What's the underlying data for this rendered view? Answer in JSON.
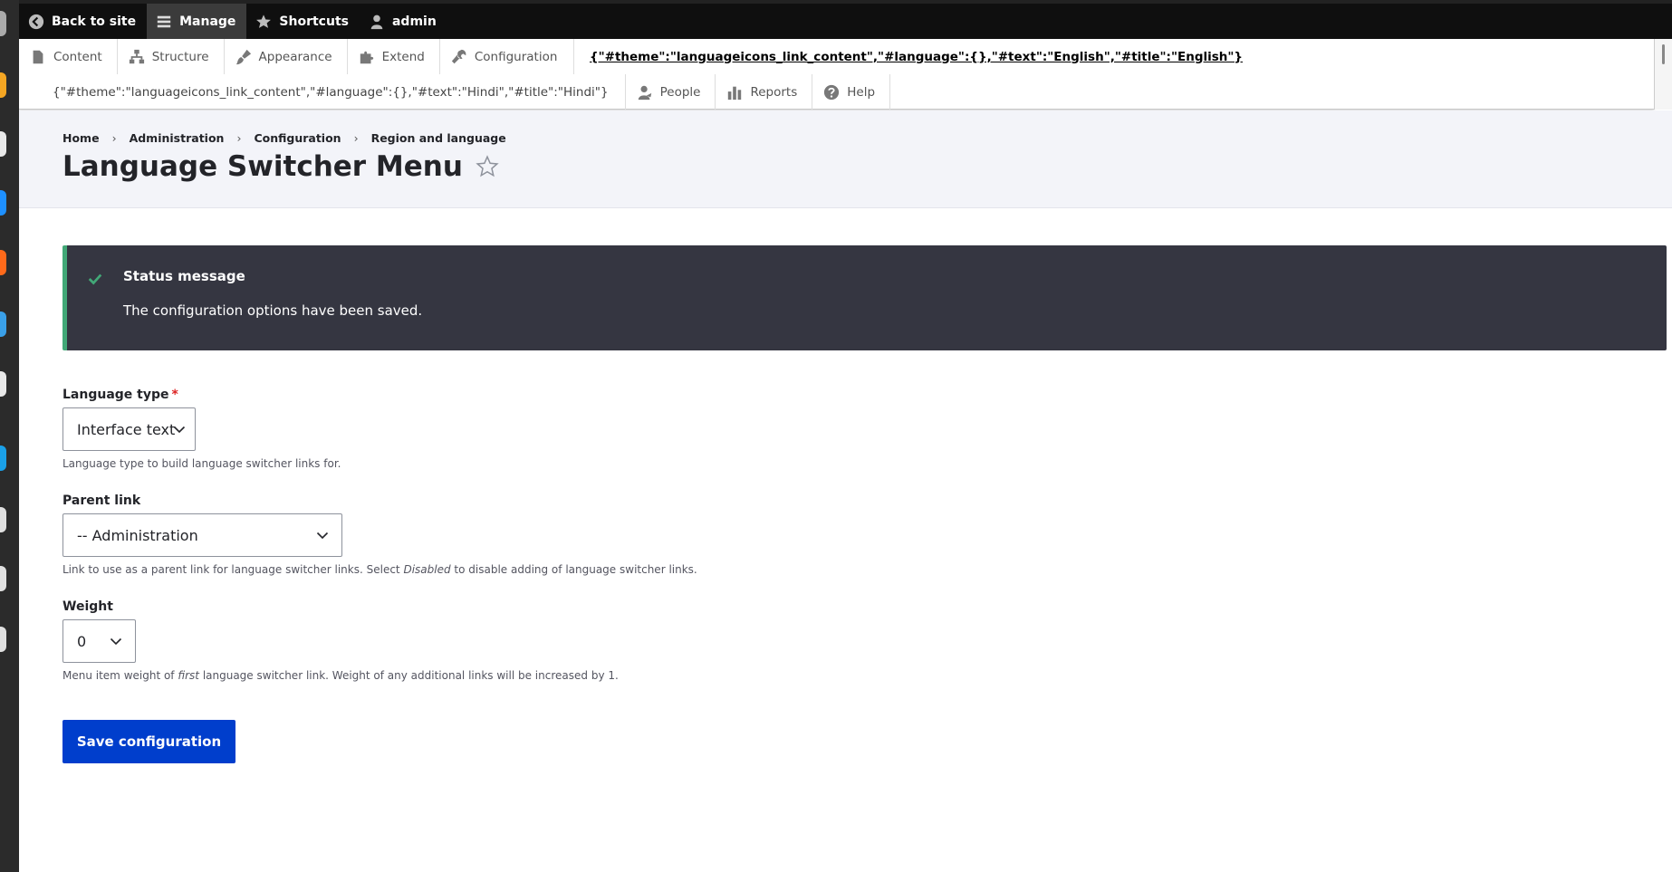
{
  "toolbar": {
    "back_label": "Back to site",
    "manage_label": "Manage",
    "shortcuts_label": "Shortcuts",
    "user_label": "admin"
  },
  "tray": {
    "content": "Content",
    "structure": "Structure",
    "appearance": "Appearance",
    "extend": "Extend",
    "configuration": "Configuration",
    "lang_english": "{\"#theme\":\"languageicons_link_content\",\"#language\":{},\"#text\":\"English\",\"#title\":\"English\"}",
    "lang_hindi": "{\"#theme\":\"languageicons_link_content\",\"#language\":{},\"#text\":\"Hindi\",\"#title\":\"Hindi\"}",
    "people": "People",
    "reports": "Reports",
    "help": "Help"
  },
  "breadcrumb": {
    "home": "Home",
    "administration": "Administration",
    "configuration": "Configuration",
    "region": "Region and language",
    "separator": "›"
  },
  "page_title": "Language Switcher Menu",
  "status": {
    "title": "Status message",
    "text": "The configuration options have been saved."
  },
  "form": {
    "language_type": {
      "label": "Language type",
      "required_mark": "*",
      "value": "Interface text",
      "desc": "Language type to build language switcher links for."
    },
    "parent_link": {
      "label": "Parent link",
      "value": "-- Administration",
      "desc_before": "Link to use as a parent link for language switcher links. Select ",
      "desc_em": "Disabled",
      "desc_after": " to disable adding of language switcher links."
    },
    "weight": {
      "label": "Weight",
      "value": "0",
      "desc_before": "Menu item weight of ",
      "desc_em": "first",
      "desc_after": " language switcher link. Weight of any additional links will be increased by 1."
    },
    "save_label": "Save configuration"
  },
  "colors": {
    "primary_button": "#003ecc",
    "status_bg": "#353641",
    "status_accent": "#42a877",
    "required": "#dc2323"
  }
}
